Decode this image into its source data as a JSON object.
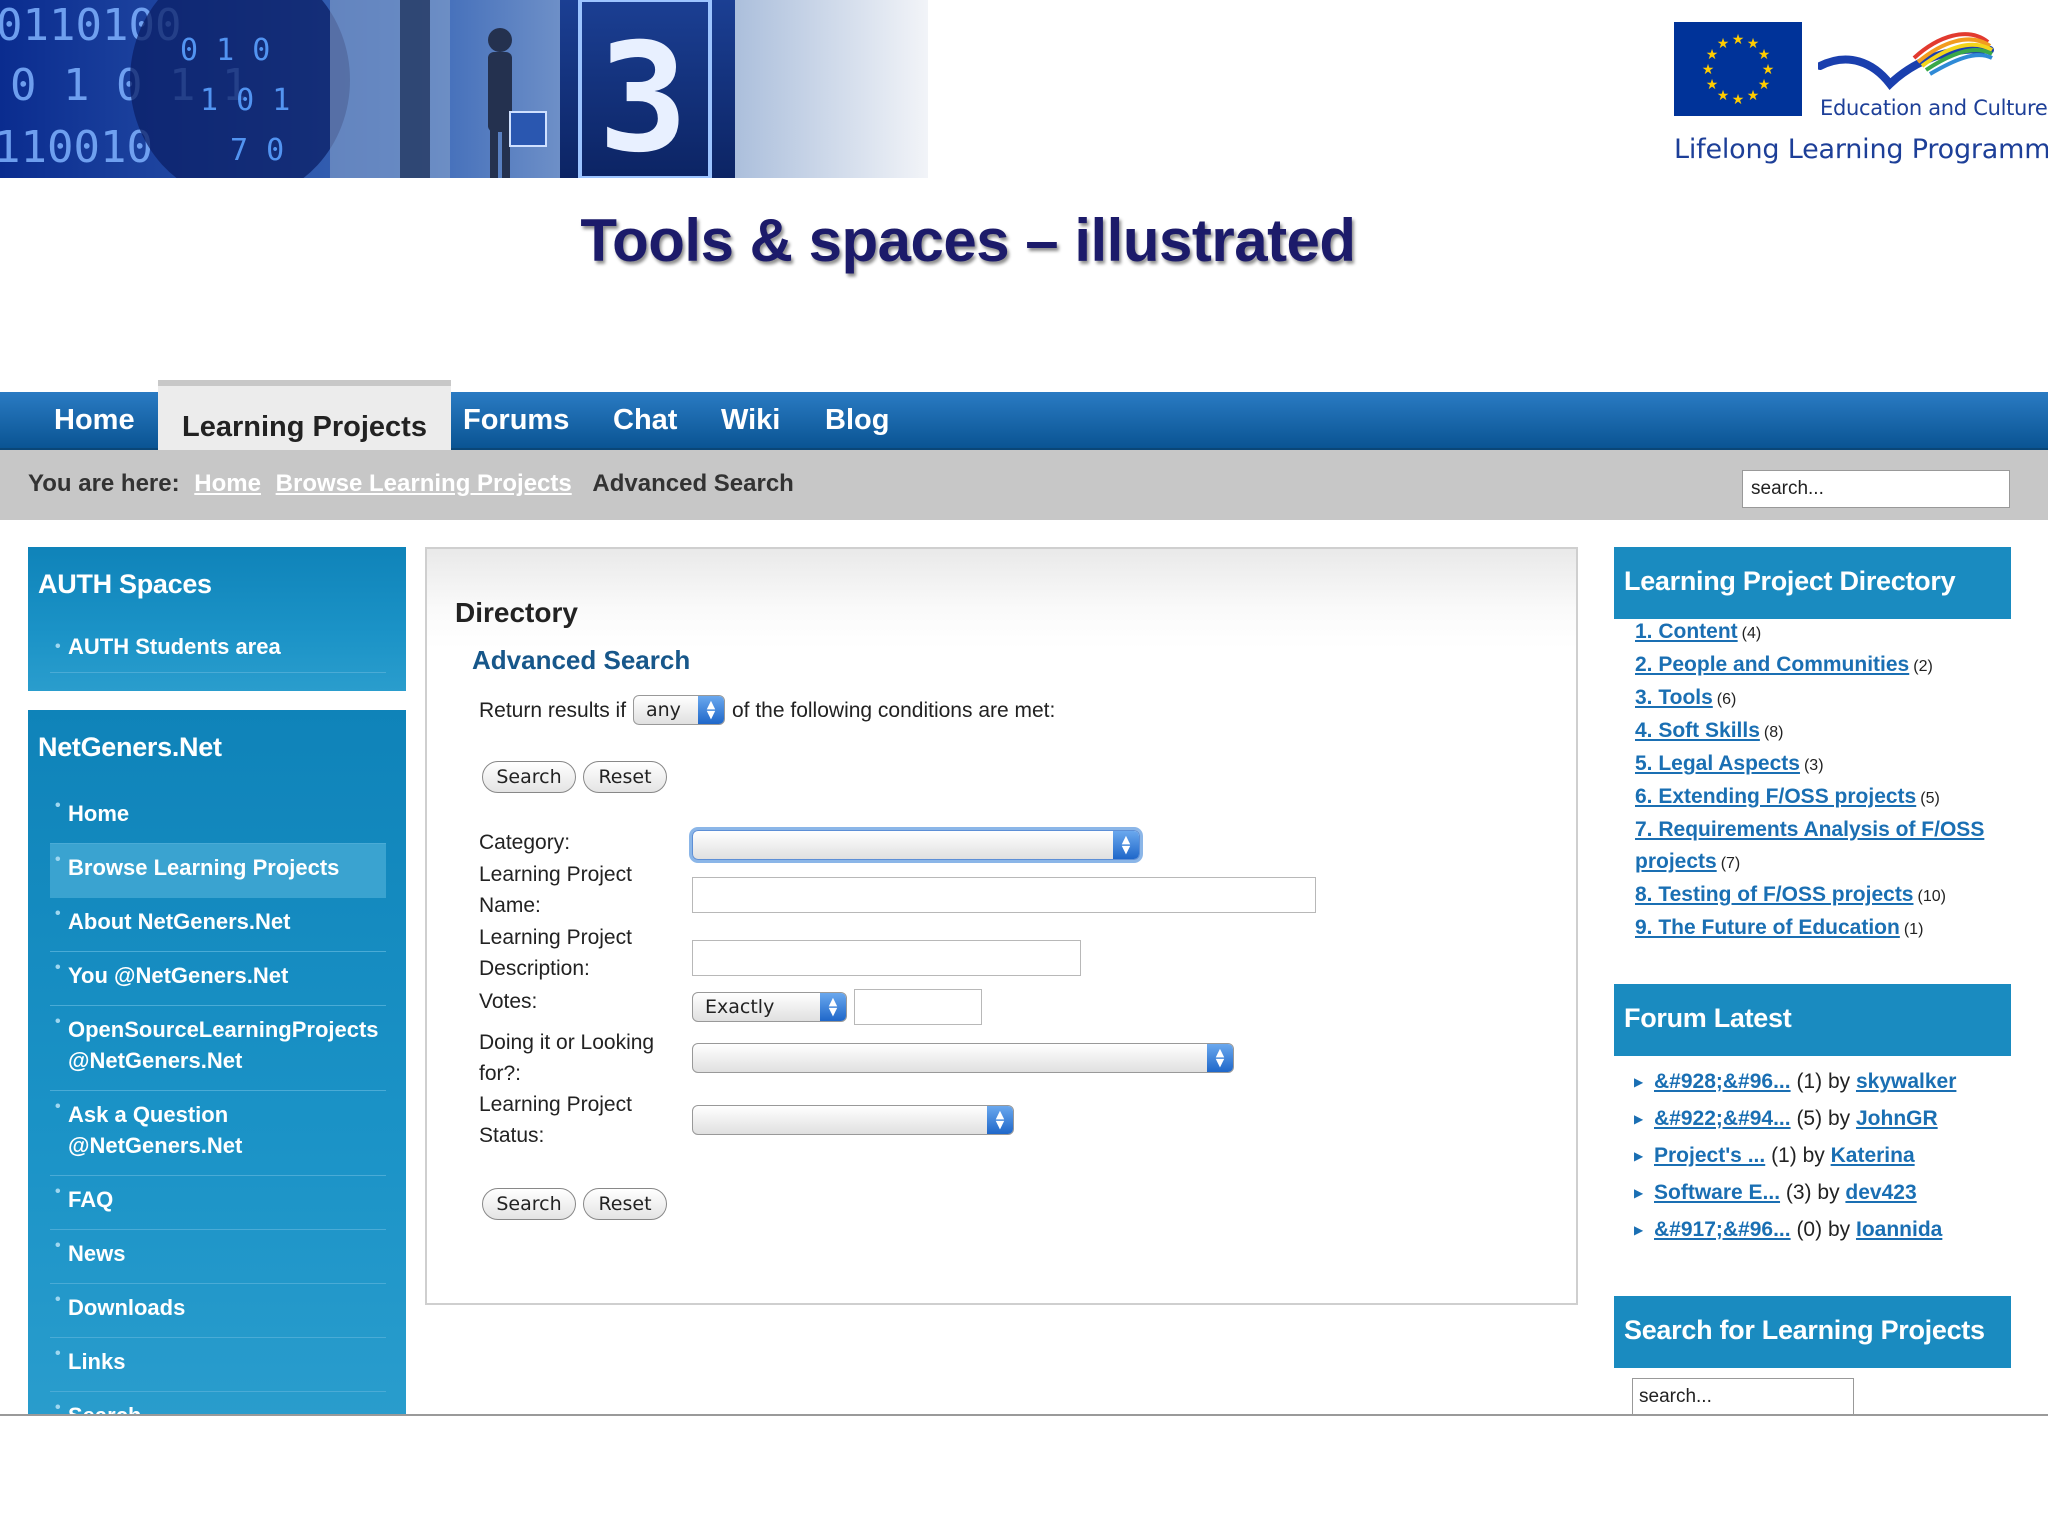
{
  "slide": {
    "title": "Tools & spaces – illustrated",
    "logo": {
      "dg": "Education and Culture DG",
      "programme": "Lifelong Learning Programme"
    }
  },
  "nav": {
    "tabs": [
      "Home",
      "Learning Projects",
      "Forums",
      "Chat",
      "Wiki",
      "Blog"
    ],
    "active": "Learning Projects"
  },
  "breadcrumb": {
    "prefix": "You are here:",
    "links": [
      "Home",
      "Browse Learning Projects"
    ],
    "current": "Advanced Search"
  },
  "top_search": {
    "value": "search..."
  },
  "auth_spaces": {
    "title": "AUTH Spaces",
    "items": [
      "AUTH Students area"
    ]
  },
  "netgeners": {
    "title": "NetGeners.Net",
    "items": [
      "Home",
      "Browse Learning Projects",
      "About NetGeners.Net",
      "You @NetGeners.Net",
      "OpenSourceLearningProjects @NetGeners.Net",
      "Ask a Question @NetGeners.Net",
      "FAQ",
      "News",
      "Downloads",
      "Links",
      "Search"
    ],
    "selected": "Browse Learning Projects"
  },
  "main": {
    "title": "Directory",
    "subtitle": "Advanced Search",
    "return_prefix": "Return results if",
    "return_value": "any",
    "return_suffix": "of the following conditions are met:",
    "search_label": "Search",
    "reset_label": "Reset",
    "fields": {
      "category": "Category:",
      "name": "Learning Project Name:",
      "description": "Learning Project Description:",
      "votes": "Votes:",
      "doing": "Doing it or Looking for?:",
      "status": "Learning Project Status:"
    },
    "votes_operator": "Exactly"
  },
  "directory": {
    "title": "Learning Project Directory",
    "items": [
      {
        "label": "1. Content",
        "count": "(4)"
      },
      {
        "label": "2. People and Communities",
        "count": "(2)"
      },
      {
        "label": "3. Tools",
        "count": "(6)"
      },
      {
        "label": "4. Soft Skills",
        "count": "(8)"
      },
      {
        "label": "5. Legal Aspects",
        "count": "(3)"
      },
      {
        "label": "6. Extending F/OSS projects",
        "count": "(5)"
      },
      {
        "label": "7. Requirements Analysis of F/OSS projects",
        "count": "(7)"
      },
      {
        "label": "8. Testing of F/OSS projects",
        "count": "(10)"
      },
      {
        "label": "9. The Future of Education",
        "count": "(1)"
      }
    ]
  },
  "forum": {
    "title": "Forum Latest",
    "items": [
      {
        "topic": "&#928;&#96...",
        "count": "(1)",
        "by": "by",
        "user": "skywalker"
      },
      {
        "topic": "&#922;&#94...",
        "count": "(5)",
        "by": "by",
        "user": "JohnGR"
      },
      {
        "topic": "Project's ...",
        "count": "(1)",
        "by": "by",
        "user": "Katerina"
      },
      {
        "topic": "Software E...",
        "count": "(3)",
        "by": "by",
        "user": "dev423"
      },
      {
        "topic": "&#917;&#96...",
        "count": "(0)",
        "by": "by",
        "user": "Ioannida"
      }
    ]
  },
  "project_search": {
    "title": "Search for Learning Projects",
    "value": "search..."
  },
  "colors": {
    "nav_blue": "#0a5493",
    "sidebar_blue": "#1a8bc0",
    "link_blue": "#1a6fb3",
    "title_navy": "#1c1b6a",
    "eu_blue": "#003399"
  }
}
